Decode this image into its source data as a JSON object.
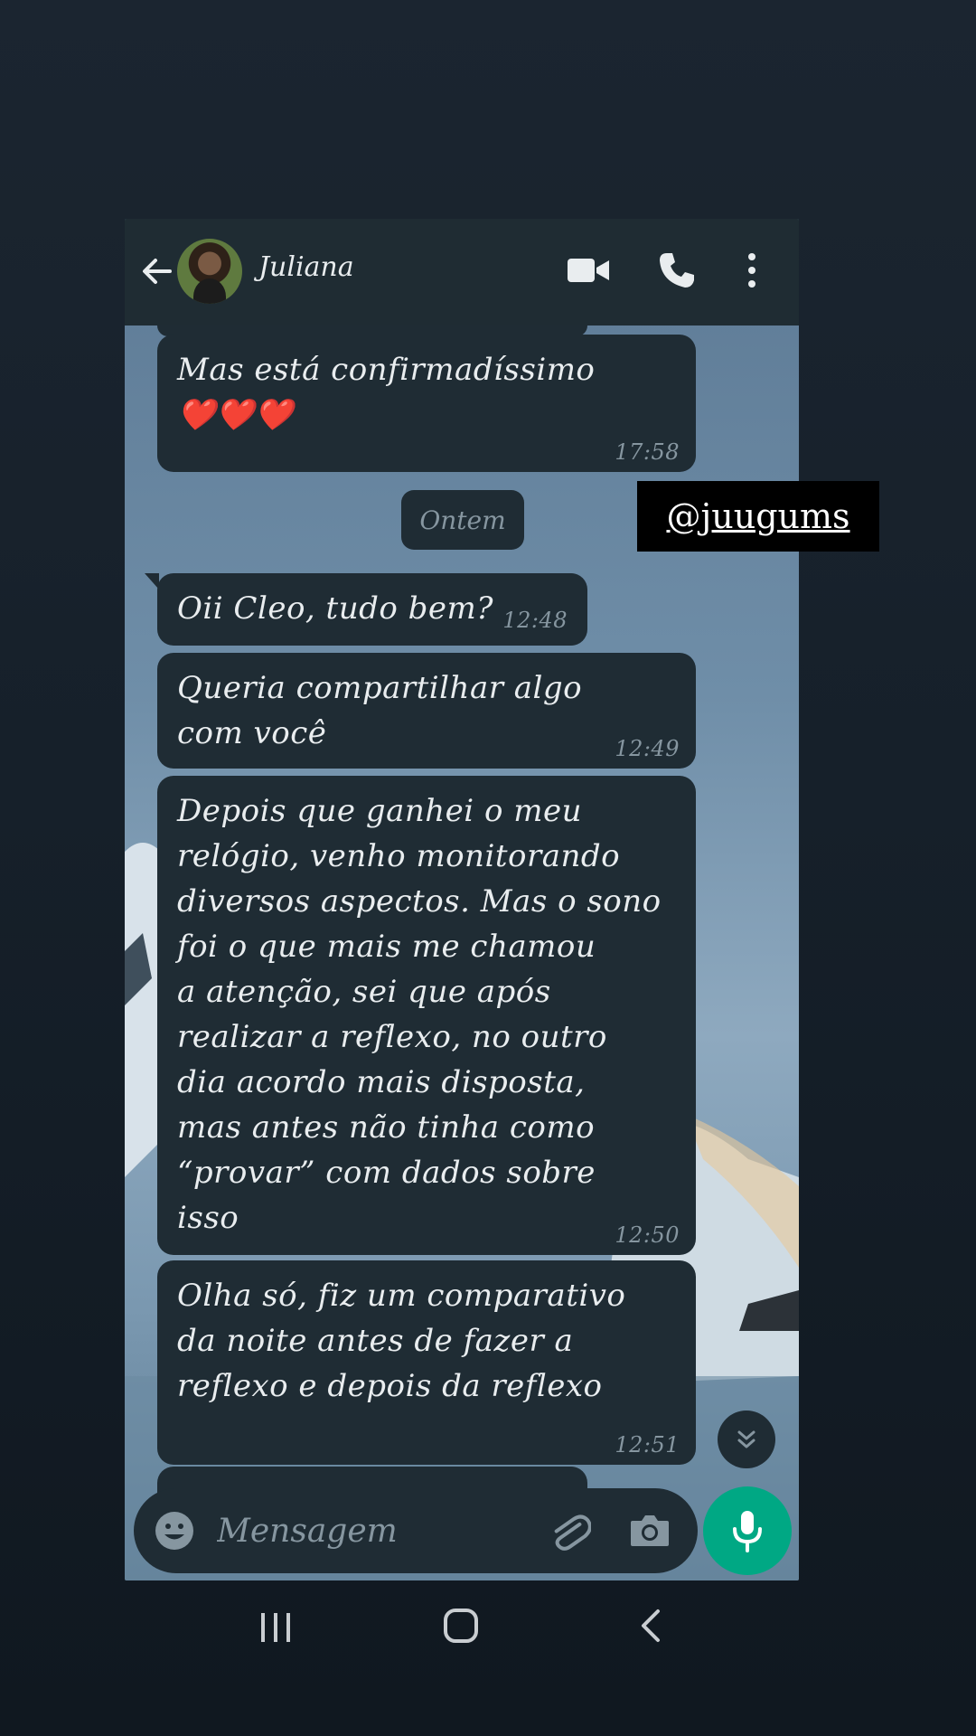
{
  "header": {
    "contact_name": "Juliana",
    "icons": [
      "back-arrow-icon",
      "avatar",
      "video-call-icon",
      "phone-call-icon",
      "more-options-icon"
    ]
  },
  "messages": [
    {
      "text": "Mas está confirmadíssimo\n❤️❤️❤️",
      "time": "17:58"
    },
    {
      "text": "Oii Cleo, tudo bem?",
      "time": "12:48"
    },
    {
      "text": "Queria compartilhar algo\ncom você",
      "time": "12:49"
    },
    {
      "text": "Depois que ganhei o meu\nrelógio, venho monitorando\ndiversos aspectos. Mas o sono\nfoi o que mais me chamou\na atenção, sei que após\nrealizar a reflexo, no outro\ndia acordo mais disposta,\nmas antes não tinha como\n“provar” com dados sobre\nisso",
      "time": "12:50"
    },
    {
      "text": "Olha só, fiz um comparativo\nda noite antes de fazer a\nreflexo e depois da reflexo",
      "time": "12:51"
    }
  ],
  "date_separator": "Ontem",
  "overlay_tag": "@juugums",
  "composer": {
    "placeholder": "Mensagem",
    "icons": [
      "emoji-icon",
      "attach-icon",
      "camera-icon",
      "mic-icon"
    ]
  },
  "colors": {
    "bubble": "#1f2c34",
    "header": "#1f2c33",
    "accent": "#00a884",
    "text": "#e9edef",
    "meta": "#8696a0"
  }
}
